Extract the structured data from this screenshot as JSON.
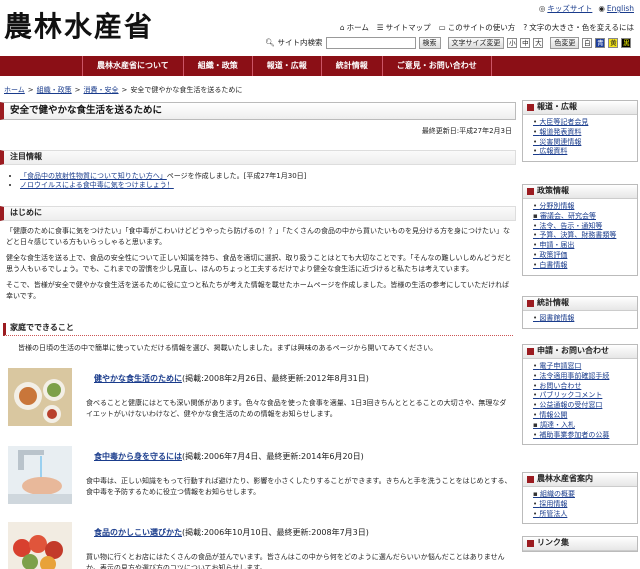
{
  "header": {
    "logo": "農林水産省",
    "util": {
      "home": "ホーム",
      "sitemap": "サイトマップ",
      "howto": "このサイトの使い方",
      "kids": "キッズサイト",
      "english": "English",
      "fontcolor": "文字の大きさ・色を変えるには"
    },
    "search": {
      "label": "サイト内検索",
      "button": "検索",
      "size_label": "文字サイズ変更",
      "sizes": [
        "小",
        "中",
        "大"
      ],
      "color_label": "色変更",
      "colors": [
        "白",
        "青",
        "黄",
        "黒"
      ]
    }
  },
  "nav": [
    "農林水産省について",
    "組織・政策",
    "報道・広報",
    "統計情報",
    "ご意見・お問い合わせ"
  ],
  "breadcrumb": [
    "ホーム",
    ">",
    "組織・政策",
    ">",
    "消費・安全",
    ">",
    "安全で健やかな食生活を送るために"
  ],
  "page": {
    "title": "安全で健やかな食生活を送るために",
    "updated": "最終更新日:平成27年2月3日",
    "notice_head": "注目情報",
    "notice": [
      {
        "link": "「食品中の放射性物質について知りたい方へ」",
        "text": "ページを作成しました。[平成27年1月30日]"
      },
      {
        "link": "ノロウイルスによる食中毒に気をつけましょう！",
        "text": ""
      }
    ],
    "intro_head": "はじめに",
    "intro": [
      "「健康のために食事に気をつけたい」「食中毒がこわいけどどうやったら防げるの！？」「たくさんの食品の中から買いたいものを見分ける方を身につけたい」などと日々感じている方もいらっしゃると思います。",
      "健全な食生活を送る上で、食品の安全性について正しい知識を持ち、食品を適切に選択、取り扱うことはとても大切なことです。「そんなの難しいしめんどうだと思う人もいるでしょう。でも、これまでの習慣を少し見直し、ほんのちょっと工夫するだけでより健全な食生活に近づけると私たちは考えています。",
      "そこで、皆様が安全で健やかな食生活を送るために役に立つと私たちが考えた情報を載せたホームページを作成しました。皆様の生活の参考にしていただければ幸いです。"
    ],
    "sub_head": "家庭でできること",
    "sub_text": "皆様の日頃の生活の中で簡単に使っていただける情報を選び、掲載いたしました。まずは興味のあるページから開いてみてください。",
    "entries": [
      {
        "title": "健やかな食生活のために",
        "meta": "(掲載:2008年2月26日、最終更新:2012年8月31日)",
        "desc": "食べることと健康にはとても深い関係があります。色々な食品を使った食事を適量、1日3回きちんとととることの大切さや、無理なダイエットがいけないわけなど、健やかな食生活のための情報をお知らせします。"
      },
      {
        "title": "食中毒から身を守るには",
        "meta": "(掲載:2006年7月4日、最終更新:2014年6月20日)",
        "desc": "食中毒は、正しい知識をもって行動すれば避けたり、影響を小さくしたりすることができます。きちんと手を洗うことをはじめとする、食中毒を予防するために役立つ情報をお知らせします。"
      },
      {
        "title": "食品のかしこい選びかた",
        "meta": "(掲載:2006年10月10日、最終更新:2008年7月3日)",
        "desc": "買い物に行くとお店にはたくさんの食品が並んでいます。皆さんはこの中から何をどのように選んだらいいか悩んだことはありませんか。表示の見方や選び方のコツについてお知らせします。"
      }
    ]
  },
  "sidebar": [
    {
      "head": "報道・広報",
      "items": [
        "大臣等記者会見",
        "報道発表資料",
        "災害関連情報",
        "広報資料"
      ]
    },
    {
      "head": "政策情報",
      "items": [
        "分野別情報",
        "審議会、研究会等",
        "法令、告示・通知等",
        "予算、決算、財務書類等",
        "申請・届出",
        "政策評価",
        "白書情報"
      ]
    },
    {
      "head": "統計情報",
      "items": [
        "図書館情報"
      ]
    },
    {
      "head": "申請・お問い合わせ",
      "items": [
        "電子申請窓口",
        "法令適用事前確認手続",
        "お問い合わせ",
        "パブリックコメント",
        "公益通報の受付窓口",
        "情報公開",
        "調達・入札",
        "補助事業参加者の公募"
      ]
    },
    {
      "head": "農林水産省案内",
      "items": [
        "組織の概要",
        "採用情報",
        "所管法人"
      ]
    },
    {
      "head": "リンク集",
      "items": []
    }
  ]
}
